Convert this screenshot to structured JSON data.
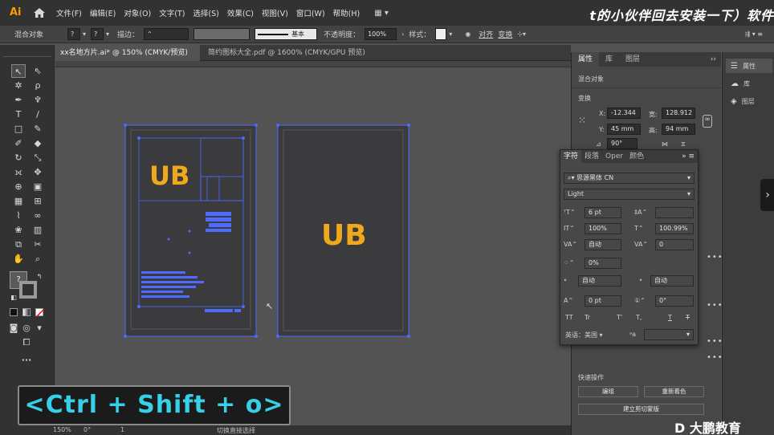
{
  "app": {
    "logo": "Ai"
  },
  "menu": [
    "文件(F)",
    "编辑(E)",
    "对象(O)",
    "文字(T)",
    "选择(S)",
    "效果(C)",
    "视图(V)",
    "窗口(W)",
    "帮助(H)"
  ],
  "banner_text": "t的小伙伴回去安装一下）软件",
  "control_bar": {
    "object_type": "混合对象",
    "stroke_label": "描边：",
    "stroke_style": "基本",
    "opacity_label": "不透明度：",
    "opacity_value": "100%",
    "style_label": "样式：",
    "align_label": "对齐",
    "transform_label": "变换"
  },
  "tabs": [
    {
      "label": "xx名地方片.ai* @ 150% (CMYK/预览)",
      "active": true
    },
    {
      "label": "简约图标大全.pdf @ 1600% (CMYK/GPU 预览)",
      "active": false
    }
  ],
  "status": {
    "zoom": "150%",
    "angle": "0°",
    "page": "1",
    "tool_hint": "切换直接选择"
  },
  "right_panel": {
    "tabs": [
      "属性",
      "库",
      "图层"
    ],
    "section_object": "混合对象",
    "section_transform": "变换",
    "x_label": "X:",
    "x_value": "-12.344",
    "y_label": "Y:",
    "y_value": "45 mm",
    "w_label": "宽:",
    "w_value": "128.912",
    "h_label": "高:",
    "h_value": "94 mm",
    "angle_value": "90°",
    "quick_actions_title": "快速操作",
    "btn_group": "编组",
    "btn_recolor": "重新着色",
    "btn_clip": "建立剪切蒙版"
  },
  "far_panel": {
    "items": [
      "属性",
      "库",
      "图层"
    ]
  },
  "char_panel": {
    "tabs": [
      "字符",
      "段落",
      "Oper",
      "颜色"
    ],
    "font_family": "思源黑体 CN",
    "font_style": "Light",
    "font_size": "6 pt",
    "leading": "",
    "vscale": "100%",
    "hscale": "100.99%",
    "kerning": "自动",
    "tracking": "0",
    "tsume": "0%",
    "aki_left": "自动",
    "aki_right": "自动",
    "baseline": "0 pt",
    "rotation": "0°",
    "language": "英语：美国",
    "caps_tt": "TT",
    "caps_tr": "Tr",
    "super": "T'",
    "sub": "T,",
    "underline": "T",
    "strike": "T"
  },
  "artboard_logo": "UB",
  "shortcut_text": "<Ctrl + Shift + o>",
  "watermark": "D 大鹏教育",
  "colors": {
    "logo_orange": "#f0a81c",
    "selection_blue": "#4d6bff",
    "artboard": "#3b3b3d",
    "shortcut_cyan": "#36d0e8"
  }
}
